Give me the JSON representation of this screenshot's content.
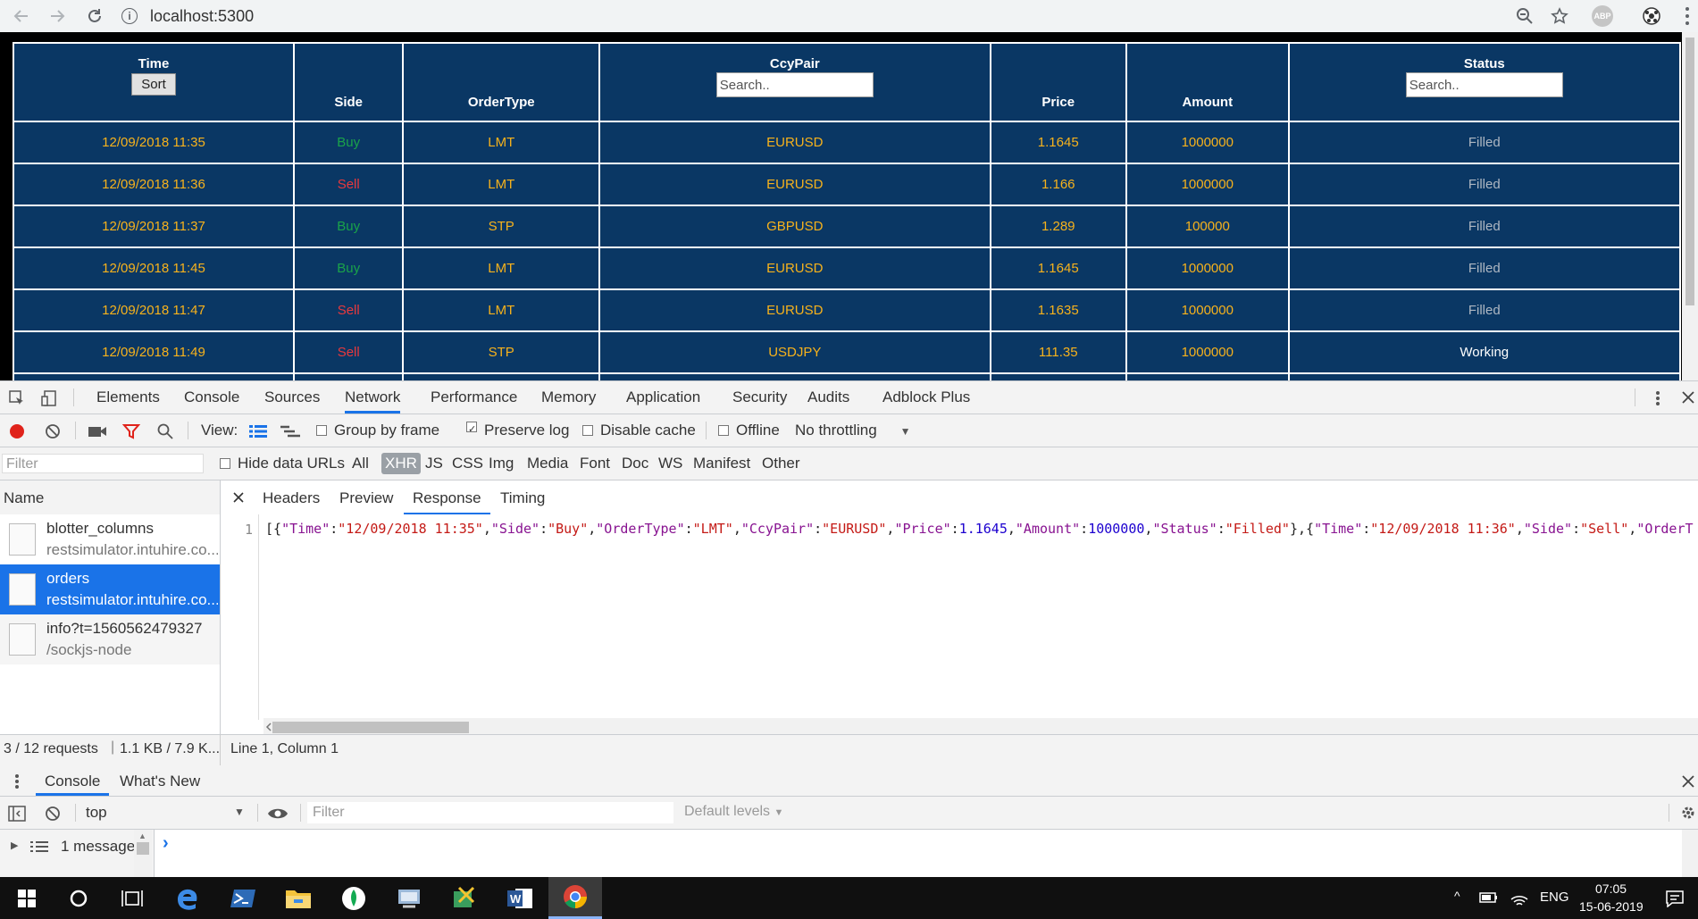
{
  "browser": {
    "url": "localhost:5300",
    "ext_label": "ABP"
  },
  "blotter": {
    "headers": {
      "time": "Time",
      "sort_button": "Sort",
      "side": "Side",
      "ordertype": "OrderType",
      "ccypair": "CcyPair",
      "ccypair_search_placeholder": "Search..",
      "price": "Price",
      "amount": "Amount",
      "status": "Status",
      "status_search_placeholder": "Search.."
    },
    "rows": [
      {
        "time": "12/09/2018 11:35",
        "side": "Buy",
        "ordertype": "LMT",
        "ccypair": "EURUSD",
        "price": "1.1645",
        "amount": "1000000",
        "status": "Filled"
      },
      {
        "time": "12/09/2018 11:36",
        "side": "Sell",
        "ordertype": "LMT",
        "ccypair": "EURUSD",
        "price": "1.166",
        "amount": "1000000",
        "status": "Filled"
      },
      {
        "time": "12/09/2018 11:37",
        "side": "Buy",
        "ordertype": "STP",
        "ccypair": "GBPUSD",
        "price": "1.289",
        "amount": "100000",
        "status": "Filled"
      },
      {
        "time": "12/09/2018 11:45",
        "side": "Buy",
        "ordertype": "LMT",
        "ccypair": "EURUSD",
        "price": "1.1645",
        "amount": "1000000",
        "status": "Filled"
      },
      {
        "time": "12/09/2018 11:47",
        "side": "Sell",
        "ordertype": "LMT",
        "ccypair": "EURUSD",
        "price": "1.1635",
        "amount": "1000000",
        "status": "Filled"
      },
      {
        "time": "12/09/2018 11:49",
        "side": "Sell",
        "ordertype": "STP",
        "ccypair": "USDJPY",
        "price": "111.35",
        "amount": "1000000",
        "status": "Working"
      }
    ],
    "colors": {
      "background": "#0a3764",
      "buy": "#1aa34a",
      "sell": "#e8383d",
      "value": "#f7b21c",
      "filled": "#aeb7c2"
    }
  },
  "devtools": {
    "tabs": [
      "Elements",
      "Console",
      "Sources",
      "Network",
      "Performance",
      "Memory",
      "Application",
      "Security",
      "Audits",
      "Adblock Plus"
    ],
    "active_tab": "Network",
    "toolbar": {
      "view_label": "View:",
      "group_by_frame": "Group by frame",
      "preserve_log": "Preserve log",
      "disable_cache": "Disable cache",
      "offline": "Offline",
      "throttling": "No throttling"
    },
    "filterbar": {
      "filter_placeholder": "Filter",
      "hide_data_urls": "Hide data URLs",
      "types": [
        "All",
        "XHR",
        "JS",
        "CSS",
        "Img",
        "Media",
        "Font",
        "Doc",
        "WS",
        "Manifest",
        "Other"
      ],
      "active_type": "XHR"
    },
    "name_header": "Name",
    "detail_tabs": [
      "Headers",
      "Preview",
      "Response",
      "Timing"
    ],
    "active_detail_tab": "Response",
    "requests": [
      {
        "name": "blotter_columns",
        "domain": "restsimulator.intuhire.co..."
      },
      {
        "name": "orders",
        "domain": "restsimulator.intuhire.co..."
      },
      {
        "name": "info?t=1560562479327",
        "domain": "/sockjs-node"
      }
    ],
    "response": {
      "line_number": "1",
      "tokens": [
        {
          "t": "[{",
          "c": "p"
        },
        {
          "t": "\"Time\"",
          "c": "k"
        },
        {
          "t": ":",
          "c": "p"
        },
        {
          "t": "\"12/09/2018 11:35\"",
          "c": "s"
        },
        {
          "t": ",",
          "c": "p"
        },
        {
          "t": "\"Side\"",
          "c": "k"
        },
        {
          "t": ":",
          "c": "p"
        },
        {
          "t": "\"Buy\"",
          "c": "s"
        },
        {
          "t": ",",
          "c": "p"
        },
        {
          "t": "\"OrderType\"",
          "c": "k"
        },
        {
          "t": ":",
          "c": "p"
        },
        {
          "t": "\"LMT\"",
          "c": "s"
        },
        {
          "t": ",",
          "c": "p"
        },
        {
          "t": "\"CcyPair\"",
          "c": "k"
        },
        {
          "t": ":",
          "c": "p"
        },
        {
          "t": "\"EURUSD\"",
          "c": "s"
        },
        {
          "t": ",",
          "c": "p"
        },
        {
          "t": "\"Price\"",
          "c": "k"
        },
        {
          "t": ":",
          "c": "p"
        },
        {
          "t": "1.1645",
          "c": "n"
        },
        {
          "t": ",",
          "c": "p"
        },
        {
          "t": "\"Amount\"",
          "c": "k"
        },
        {
          "t": ":",
          "c": "p"
        },
        {
          "t": "1000000",
          "c": "n"
        },
        {
          "t": ",",
          "c": "p"
        },
        {
          "t": "\"Status\"",
          "c": "k"
        },
        {
          "t": ":",
          "c": "p"
        },
        {
          "t": "\"Filled\"",
          "c": "s"
        },
        {
          "t": "},{",
          "c": "p"
        },
        {
          "t": "\"Time\"",
          "c": "k"
        },
        {
          "t": ":",
          "c": "p"
        },
        {
          "t": "\"12/09/2018 11:36\"",
          "c": "s"
        },
        {
          "t": ",",
          "c": "p"
        },
        {
          "t": "\"Side\"",
          "c": "k"
        },
        {
          "t": ":",
          "c": "p"
        },
        {
          "t": "\"Sell\"",
          "c": "s"
        },
        {
          "t": ",",
          "c": "p"
        },
        {
          "t": "\"OrderT",
          "c": "k"
        }
      ]
    },
    "statusbar": {
      "requests": "3 / 12 requests",
      "transferred": "1.1 KB / 7.9 K...",
      "cursor": "Line 1, Column 1"
    },
    "drawer": {
      "tabs": [
        "Console",
        "What's New"
      ],
      "active_tab": "Console",
      "context": "top",
      "filter_placeholder": "Filter",
      "levels": "Default levels",
      "sidebar_item": "1 message",
      "prompt": "›"
    }
  },
  "taskbar": {
    "lang": "ENG",
    "time": "07:05",
    "date": "15-06-2019"
  }
}
